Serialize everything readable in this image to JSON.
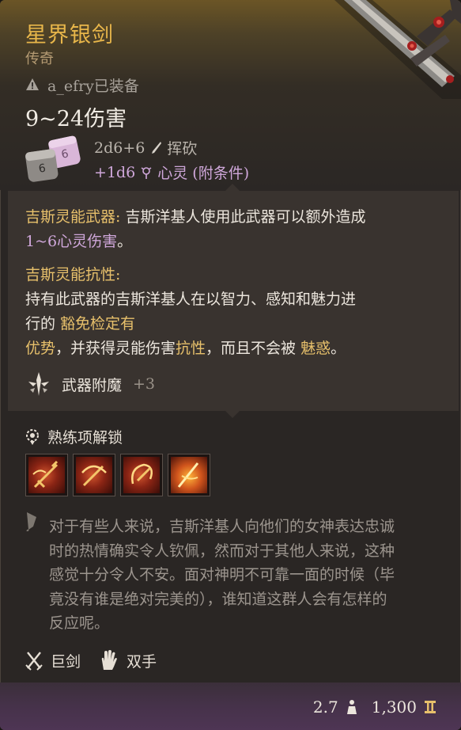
{
  "item": {
    "name": "星界银剑",
    "rarity": "传奇",
    "equipped_by": "a_efry已装备",
    "damage": "9~24伤害",
    "damage_lines": [
      {
        "dice": "2d6+6",
        "type": "挥砍"
      },
      {
        "dice": "+1d6",
        "type": "心灵 (附条件)"
      }
    ]
  },
  "abilities": {
    "psionic_weapon": {
      "title": "吉斯灵能武器:",
      "text": " 吉斯洋基人使用此武器可以额外造成",
      "highlight": "1~6心灵伤害",
      "end": "。"
    },
    "psionic_resistance": {
      "title": "吉斯灵能抗性:",
      "line1": "持有此武器的吉斯洋基人在以智力、感知和魅力进",
      "line2a": "行的 ",
      "line2b": "豁免检定有",
      "line3a": "优势",
      "line3b": "，并获得灵能伤害",
      "line3c": "抗性",
      "line3d": "，而且不会被 ",
      "line3e": "魅惑",
      "line3f": "。"
    }
  },
  "enchant": {
    "label": "武器附魔",
    "value": "+3"
  },
  "proficiency": {
    "label": "熟练项解锁",
    "skills": [
      "skill-1",
      "skill-2",
      "skill-3",
      "skill-4"
    ]
  },
  "lore": [
    "对于有些人来说，吉斯洋基人向他们的女神表达忠诚",
    "时的热情确实令人钦佩，然而对于其他人来说，这种",
    "感觉十分令人不安。面对神明不可靠一面的时候（毕",
    "竟没有谁是绝对完美的），谁知道这群人会有怎样的",
    "反应呢。"
  ],
  "tags": {
    "type": "巨剑",
    "handedness": "双手"
  },
  "footer": {
    "weight": "2.7",
    "price": "1,300"
  },
  "colors": {
    "title": "#e7b84e",
    "highlight": "#cfa7da",
    "accent_gold": "#e7c06b"
  }
}
